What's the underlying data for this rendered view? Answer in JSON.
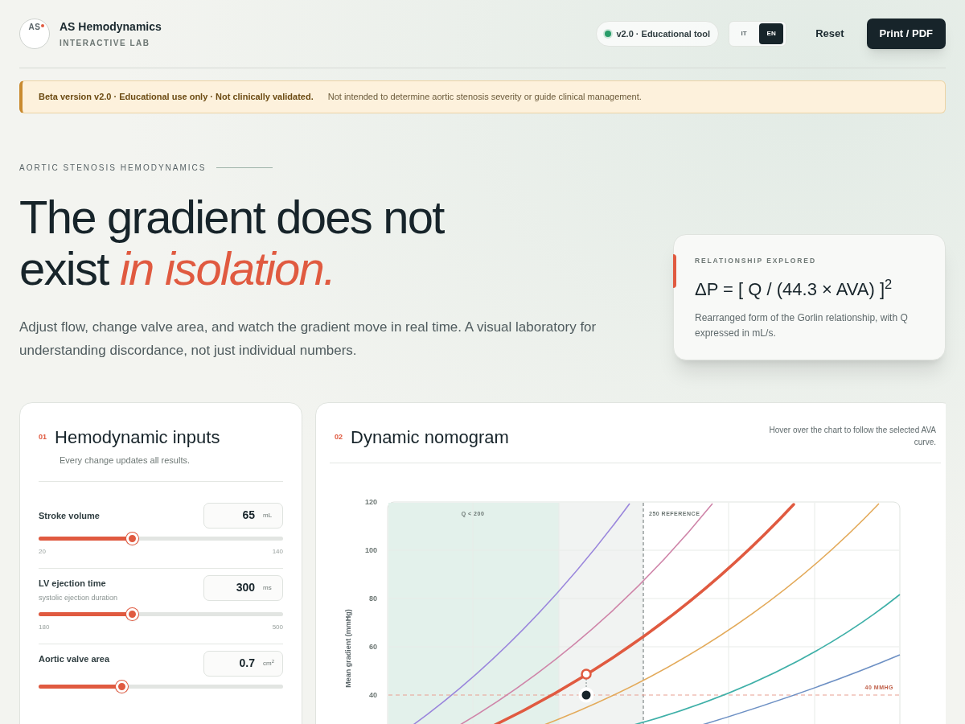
{
  "header": {
    "logo_text": "AS",
    "app_name": "AS Hemodynamics",
    "app_subtitle": "INTERACTIVE LAB",
    "version_badge": "v2.0 · Educational tool",
    "languages": [
      {
        "label": "IT",
        "selected": false
      },
      {
        "label": "EN",
        "selected": true
      }
    ],
    "reset_button": "Reset",
    "print_button": "Print / PDF"
  },
  "banner": {
    "title": "Beta version v2.0 · Educational use only · Not clinically validated.",
    "text": "Not intended to determine aortic stenosis severity or guide clinical management."
  },
  "hero": {
    "eyebrow": "AORTIC STENOSIS HEMODYNAMICS",
    "headline_line_1": "The gradient does not",
    "headline_line_2": "exist *in isolation.*",
    "intro": "Adjust flow, change valve area, and watch the gradient move in real time. A visual laboratory for understanding discordance, not just individual numbers."
  },
  "formula_card": {
    "eyebrow": "RELATIONSHIP EXPLORED",
    "formula": "ΔP = [ Q / (44.3 × AVA) ]$^{2}$",
    "note": "Rearranged form of the Gorlin relationship, with Q expressed in mL/s."
  },
  "inputs_panel": {
    "number": "01",
    "title": "Hemodynamic inputs",
    "subtitle": "Every change updates all results.",
    "inputs": [
      {
        "label": "Stroke volume",
        "value": "65",
        "unit": "mL",
        "level": 0.38,
        "min": "20",
        "max": "140"
      },
      {
        "label": "LV ejection time",
        "hint": "systolic ejection duration",
        "value": "300",
        "unit": "ms",
        "level": 0.38,
        "min": "180",
        "max": "500"
      },
      {
        "label": "Aortic valve area",
        "value": "0.7",
        "unit": "cm$^{2}$",
        "level": 0.34
      }
    ]
  },
  "nomogram_panel": {
    "number": "02",
    "title": "Dynamic nomogram",
    "hint": "Hover over the chart to follow the selected AVA curve.",
    "y_axis_label": "Mean gradient (mmHg)",
    "y_ticks": [
      "120",
      "100",
      "80",
      "60",
      "40"
    ],
    "low_flow_label": "Q < 200",
    "reference_label": "250 REFERENCE",
    "threshold_label": "40 MMHG"
  }
}
